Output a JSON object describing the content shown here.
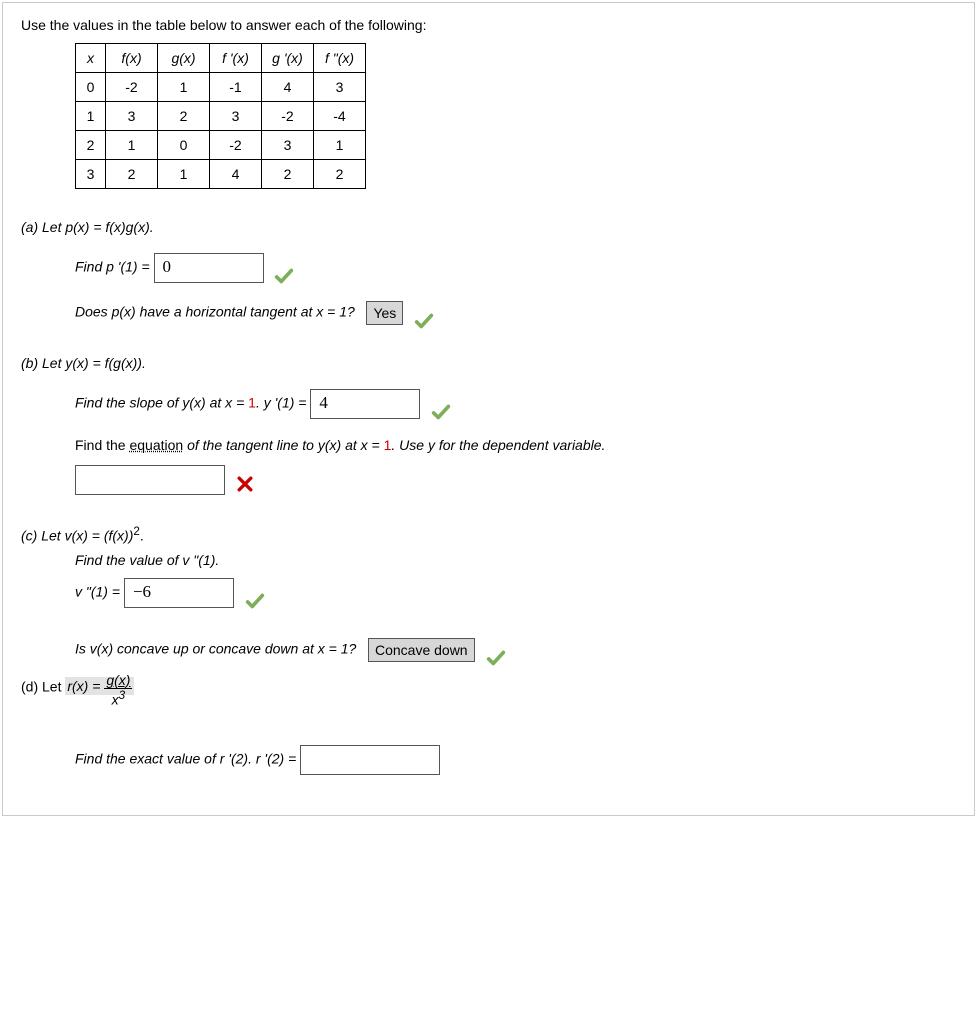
{
  "prompt": "Use the values in the table below to answer each of the following:",
  "table": {
    "headers": [
      "x",
      "f(x)",
      "g(x)",
      "f '(x)",
      "g '(x)",
      "f \"(x)"
    ],
    "rows": [
      [
        "0",
        "-2",
        "1",
        "-1",
        "4",
        "3"
      ],
      [
        "1",
        "3",
        "2",
        "3",
        "-2",
        "-4"
      ],
      [
        "2",
        "1",
        "0",
        "-2",
        "3",
        "1"
      ],
      [
        "3",
        "2",
        "1",
        "4",
        "2",
        "2"
      ]
    ]
  },
  "a": {
    "def": "(a) Let p(x) = f(x)g(x).",
    "find_label": "Find p '(1) =",
    "ans": "0",
    "hq": "Does p(x) have a horizontal tangent at x = 1?",
    "hq_ans": "Yes"
  },
  "b": {
    "def": "(b) Let y(x) = f(g(x)).",
    "slope_pre": "Find the slope of y(x) at x = ",
    "slope_one": "1",
    "slope_post": ". y '(1) =",
    "slope_ans": "4",
    "eq_pre": "Find the ",
    "eq_word": "equation",
    "eq_post": " of the tangent line to y(x) at x = ",
    "eq_one": "1",
    "eq_tail": ". Use y for the dependent variable.",
    "eq_ans": ""
  },
  "c": {
    "def_pre": "(c) Let v(x) = (f(x))",
    "def_exp": "2",
    "def_post": ".",
    "find_label": "Find the value of v \"(1).",
    "v_label": "v \"(1) =",
    "v_ans": "−6",
    "concave_q": "Is v(x) concave up or concave down at x = 1?",
    "concave_ans": "Concave down"
  },
  "d": {
    "def_pre": "(d) Let",
    "def_r": "r(x) =",
    "frac_num": "g(x)",
    "frac_den_x": "x",
    "frac_den_exp": "3",
    "find_label": "Find the exact value of r '(2). r '(2) ="
  }
}
